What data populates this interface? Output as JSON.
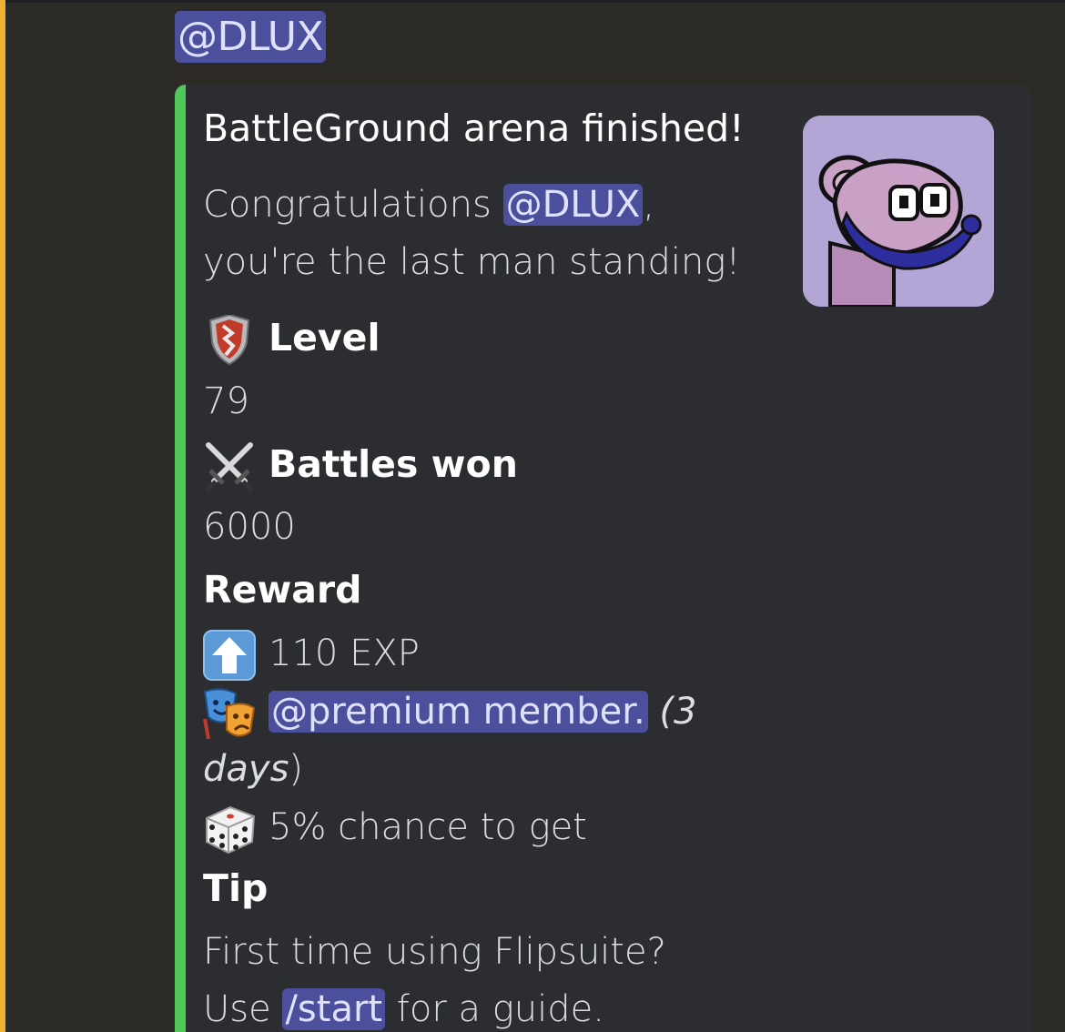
{
  "message": {
    "mention": "@DLUX"
  },
  "embed": {
    "title": "BattleGround arena finished!",
    "description": {
      "prefix": "Congratulations ",
      "mention": "@DLUX",
      "suffix": ",",
      "line2": "you're the last man standing!"
    },
    "fields": {
      "level_name": "Level",
      "level_value": "79",
      "battles_name": "Battles won",
      "battles_value": "6000",
      "reward_name": "Reward",
      "reward_exp": "110 EXP",
      "reward_role_mention": "@premium member.",
      "reward_role_duration_a": "(3",
      "reward_role_duration_b": "days",
      "reward_role_duration_c": ")",
      "reward_chance": "5% chance to get",
      "tip_name": "Tip",
      "tip_line1": "First time using Flipsuite?",
      "tip_prefix": "Use ",
      "tip_command": "/start",
      "tip_suffix": " for a guide."
    },
    "icons": {
      "level": "shield-icon",
      "battles": "crossed-swords-icon",
      "exp": "up-arrow-icon",
      "role": "performing-arts-icon",
      "chance": "dice-icon"
    },
    "colors": {
      "accent_bar": "#4ec95a",
      "mention_bg": "#4b4f9c",
      "highlight_bar": "#f0b232",
      "embed_bg": "#2b2d31"
    }
  }
}
